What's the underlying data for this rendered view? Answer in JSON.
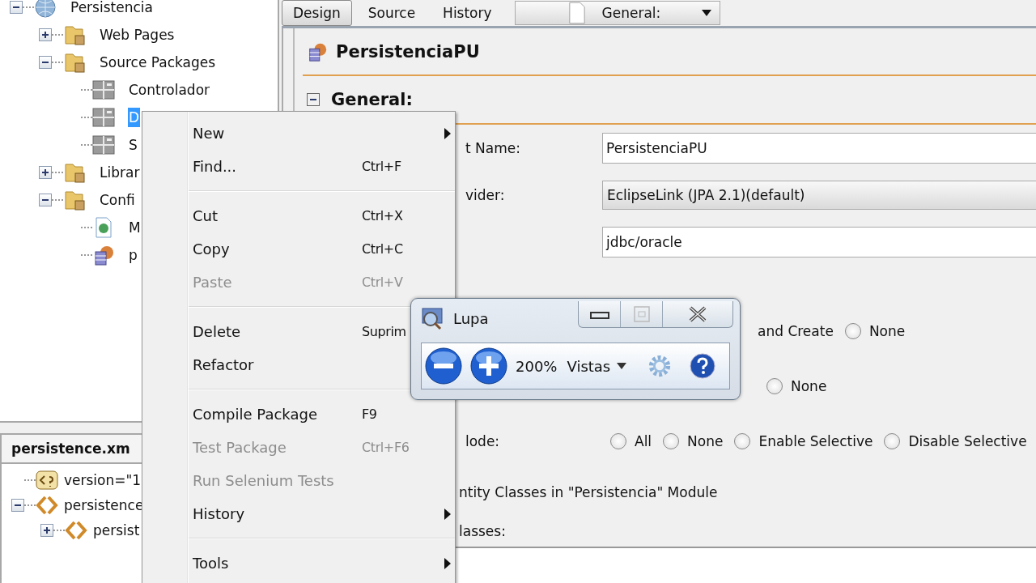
{
  "project_tree": {
    "items": [
      {
        "label": "Persistencia",
        "kind": "project",
        "expanded": true,
        "selected": false,
        "children": [
          {
            "label": "Web Pages",
            "kind": "folder",
            "expanded": false,
            "selected": false
          },
          {
            "label": "Source Packages",
            "kind": "folder",
            "expanded": true,
            "selected": false,
            "children": [
              {
                "label": "Controlador",
                "kind": "package",
                "selected": false
              },
              {
                "label": "D",
                "kind": "package",
                "selected": true
              },
              {
                "label": "S",
                "kind": "package",
                "selected": false
              }
            ]
          },
          {
            "label": "Librar",
            "kind": "folder",
            "expanded": false,
            "selected": false
          },
          {
            "label": "Confi",
            "kind": "folder",
            "expanded": true,
            "selected": false,
            "children": [
              {
                "label": "M",
                "kind": "webfile",
                "selected": false
              },
              {
                "label": "p",
                "kind": "pu",
                "selected": false
              }
            ]
          }
        ]
      }
    ]
  },
  "navigator": {
    "title": "persistence.xm",
    "items": [
      {
        "label": "version=\"1",
        "kind": "pi"
      },
      {
        "label": "persistence",
        "kind": "element",
        "expanded": true,
        "children": [
          {
            "label": "persist",
            "kind": "element",
            "expanded": false
          }
        ]
      }
    ]
  },
  "editor": {
    "tabs": [
      {
        "label": "Design",
        "selected": true
      },
      {
        "label": "Source",
        "selected": false
      },
      {
        "label": "History",
        "selected": false
      }
    ],
    "view_combo": {
      "value": "General:"
    },
    "title": "PersistenciaPU",
    "section": {
      "title": "General:",
      "expanded": true
    },
    "fields": [
      {
        "label": "t Name:",
        "kind": "text",
        "value": "PersistenciaPU"
      },
      {
        "label": "vider:",
        "kind": "combo",
        "value": "EclipseLink (JPA 2.1)(default)"
      },
      {
        "kind": "text",
        "value": "jdbc/oracle"
      }
    ],
    "option_rows": [
      {
        "options": [
          {
            "label": "and Create"
          },
          {
            "label": "None",
            "selected": false
          }
        ]
      },
      {
        "options": [
          {
            "label": "None",
            "selected": false
          }
        ]
      },
      {
        "label": "lode:",
        "options": [
          {
            "label": "All",
            "selected": false
          },
          {
            "label": "None",
            "selected": false
          },
          {
            "label": "Enable Selective",
            "selected": false
          },
          {
            "label": "Disable Selective",
            "selected": false
          }
        ]
      }
    ],
    "entity_note": "ntity Classes in \"Persistencia\" Module",
    "classes_label": "lasses:"
  },
  "context_menu": {
    "items": [
      {
        "kind": "item",
        "label": "New",
        "submenu": true,
        "disabled": false
      },
      {
        "kind": "item",
        "label": "Find...",
        "shortcut": "Ctrl+F",
        "submenu": false,
        "disabled": false
      },
      {
        "kind": "separator"
      },
      {
        "kind": "item",
        "label": "Cut",
        "shortcut": "Ctrl+X",
        "submenu": false,
        "disabled": false
      },
      {
        "kind": "item",
        "label": "Copy",
        "shortcut": "Ctrl+C",
        "submenu": false,
        "disabled": false
      },
      {
        "kind": "item",
        "label": "Paste",
        "shortcut": "Ctrl+V",
        "submenu": false,
        "disabled": true
      },
      {
        "kind": "separator"
      },
      {
        "kind": "item",
        "label": "Delete",
        "shortcut": "Suprim",
        "submenu": false,
        "disabled": false
      },
      {
        "kind": "item",
        "label": "Refactor",
        "submenu": false,
        "disabled": false
      },
      {
        "kind": "separator"
      },
      {
        "kind": "item",
        "label": "Compile Package",
        "shortcut": "F9",
        "submenu": false,
        "disabled": false
      },
      {
        "kind": "item",
        "label": "Test Package",
        "shortcut": "Ctrl+F6",
        "submenu": false,
        "disabled": true
      },
      {
        "kind": "item",
        "label": "Run Selenium Tests",
        "submenu": false,
        "disabled": true
      },
      {
        "kind": "item",
        "label": "History",
        "submenu": true,
        "disabled": false
      },
      {
        "kind": "separator"
      },
      {
        "kind": "item",
        "label": "Tools",
        "submenu": true,
        "disabled": false
      }
    ]
  },
  "magnifier": {
    "title": "Lupa",
    "zoom": "200%",
    "views": "Vistas"
  }
}
